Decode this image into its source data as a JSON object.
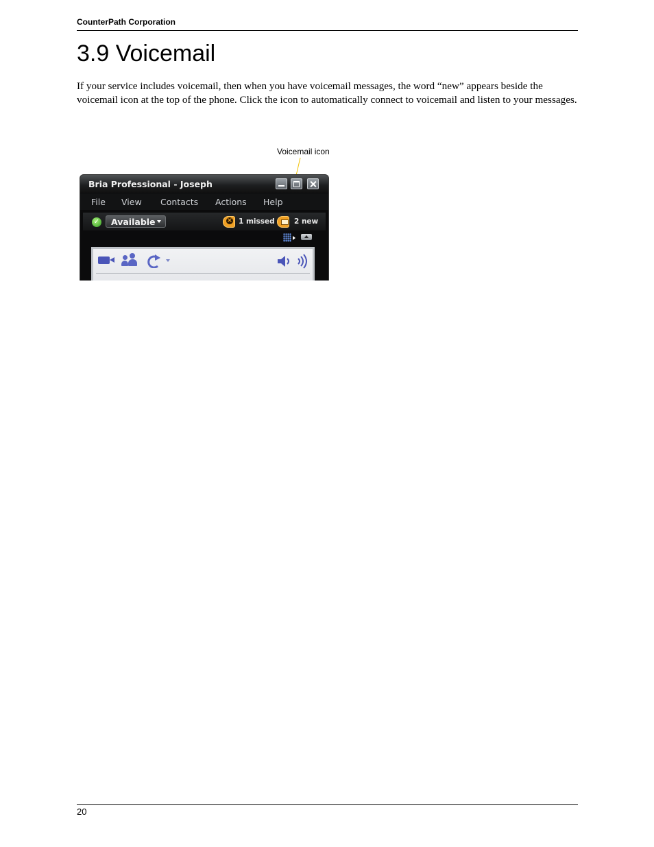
{
  "header": {
    "company": "CounterPath Corporation"
  },
  "section": {
    "title": "3.9 Voicemail",
    "body": "If your service includes voicemail, then when you have voicemail messages, the word “new” appears beside the voicemail icon at the top of the phone. Click the icon to automatically connect to voicemail and listen to your messages."
  },
  "figure": {
    "callout_label": "Voicemail icon",
    "window": {
      "title": "Bria Professional - Joseph",
      "menu": [
        "File",
        "View",
        "Contacts",
        "Actions",
        "Help"
      ],
      "presence": "Available",
      "missed_label": "1 missed",
      "voicemail_label": "2 new"
    },
    "colors": {
      "window_bg": "#0b0b0c",
      "accent_orange": "#f0a023",
      "icon_blue": "#4a55b8",
      "callout_line": "#f2c200"
    },
    "icons": [
      "minimize-icon",
      "maximize-icon",
      "close-icon",
      "available-status-icon",
      "missed-call-icon",
      "voicemail-icon",
      "dialpad-icon",
      "collapse-icon",
      "video-camera-icon",
      "conference-icon",
      "transfer-icon",
      "speaker-icon",
      "microphone-icon"
    ]
  },
  "footer": {
    "page_number": "20"
  }
}
